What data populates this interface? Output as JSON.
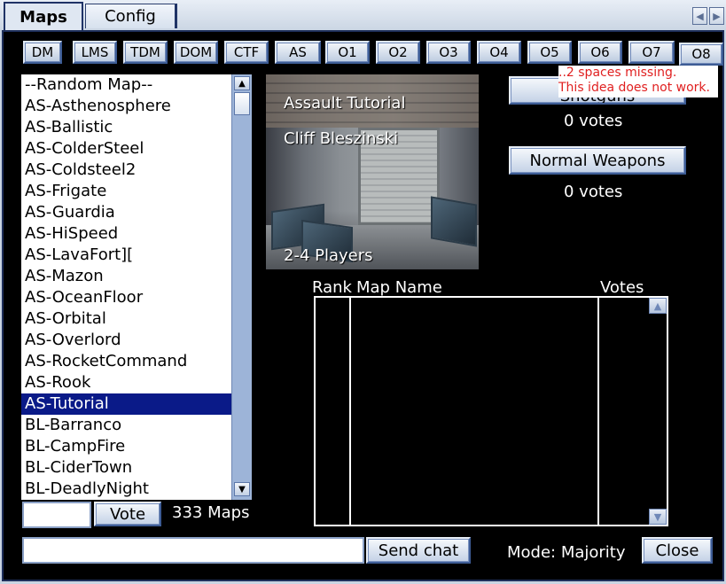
{
  "tabs": [
    {
      "label": "Maps",
      "active": true
    },
    {
      "label": "Config",
      "active": false
    }
  ],
  "gametypes": [
    "DM",
    "LMS",
    "TDM",
    "DOM",
    "CTF",
    "AS",
    "O1",
    "O2",
    "O3",
    "O4",
    "O5",
    "O6",
    "O7",
    "O8"
  ],
  "maps": [
    "--Random Map--",
    "AS-Asthenosphere",
    "AS-Ballistic",
    "AS-ColderSteel",
    "AS-Coldsteel2",
    "AS-Frigate",
    "AS-Guardia",
    "AS-HiSpeed",
    "AS-LavaFort][",
    "AS-Mazon",
    "AS-OceanFloor",
    "AS-Orbital",
    "AS-Overlord",
    "AS-RocketCommand",
    "AS-Rook",
    "AS-Tutorial",
    "BL-Barranco",
    "BL-CampFire",
    "BL-CiderTown",
    "BL-DeadlyNight"
  ],
  "selected_map_index": 15,
  "map_count_label": "333 Maps",
  "vote_button": "Vote",
  "vote_input_value": "",
  "preview": {
    "title": "Assault Tutorial",
    "author": "Cliff Bleszinski",
    "players": "2-4 Players"
  },
  "options": [
    {
      "label": "Shotguns",
      "votes": "0 votes"
    },
    {
      "label": "Normal Weapons",
      "votes": "0 votes"
    }
  ],
  "note": {
    "line1": "..2 spaces missing.",
    "line2": "This idea does not work."
  },
  "rank_table": {
    "headers": [
      "Rank",
      "Map Name",
      "Votes"
    ],
    "rows": []
  },
  "chat": {
    "input_value": "",
    "send_label": "Send chat"
  },
  "mode_label": "Mode: Majority",
  "close_label": "Close",
  "colors": {
    "panel_bg": "#000000",
    "selection": "#0a1a88",
    "note_text": "#e02020",
    "scrollbar": "#9db4d8"
  }
}
